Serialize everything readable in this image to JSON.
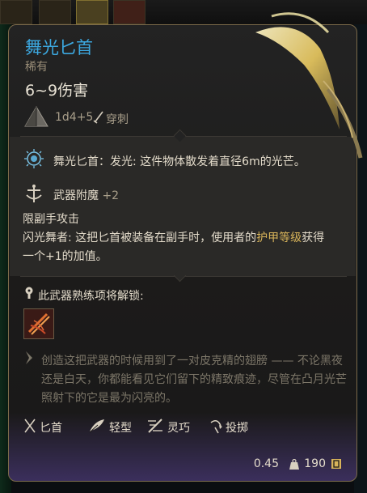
{
  "item": {
    "name": "舞光匕首",
    "rarity": "稀有",
    "damage": "6~9伤害",
    "dice": "1d4+5",
    "damage_type": "穿刺"
  },
  "effects": {
    "light": "舞光匕首：发光: 这件物体散发着直径6m的光芒。",
    "enchant_label": "武器附魔",
    "enchant_value": "+2",
    "offhand": "限副手攻击",
    "passive_name": "闪光舞者",
    "passive_a": ": 这把匕首被装备在副手时，使用者的",
    "passive_gold": "护甲等级",
    "passive_b": "获得一个+1的加值。"
  },
  "proficiency": {
    "title": "此武器熟练项将解锁:"
  },
  "flavor": "创造这把武器的时候用到了一对皮克精的翅膀 —— 不论黑夜还是白天，你都能看见它们留下的精致痕迹，尽管在凸月光芒照射下的它是最为闪亮的。",
  "properties": [
    {
      "icon": "dagger-icon",
      "label": "匕首"
    },
    {
      "icon": "feather-icon",
      "label": "轻型"
    },
    {
      "icon": "finesse-icon",
      "label": "灵巧"
    },
    {
      "icon": "throw-icon",
      "label": "投掷"
    }
  ],
  "footer": {
    "weight": "0.45",
    "price": "190"
  },
  "colors": {
    "name": "#3ca8e0",
    "gold": "#d8b45a",
    "border": "#7b6a4a"
  }
}
